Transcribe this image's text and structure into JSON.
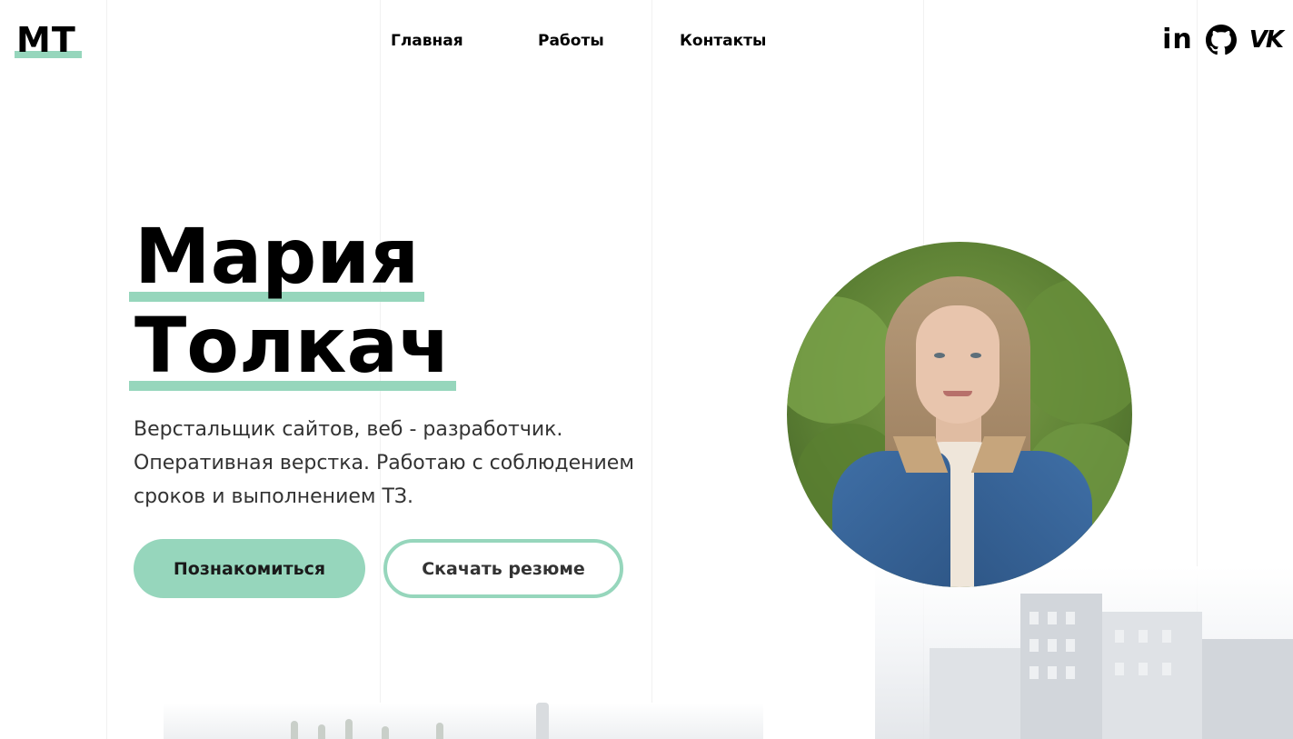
{
  "header": {
    "logo": "MT",
    "nav": [
      {
        "label": "Главная"
      },
      {
        "label": "Работы"
      },
      {
        "label": "Контакты"
      }
    ],
    "socials": [
      {
        "icon": "linkedin-icon",
        "label": "in"
      },
      {
        "icon": "github-icon"
      },
      {
        "icon": "vk-icon",
        "label": "VK"
      }
    ]
  },
  "hero": {
    "first_name": "Мария",
    "last_name": "Толкач",
    "description": "Верстальщик сайтов, веб - разработчик. Оперативная верстка. Работаю с соблюдением сроков и выполнением ТЗ.",
    "primary_button": "Познакомиться",
    "secondary_button": "Скачать резюме"
  },
  "colors": {
    "accent": "#96d6bc",
    "text": "#111111",
    "background": "#ffffff"
  }
}
